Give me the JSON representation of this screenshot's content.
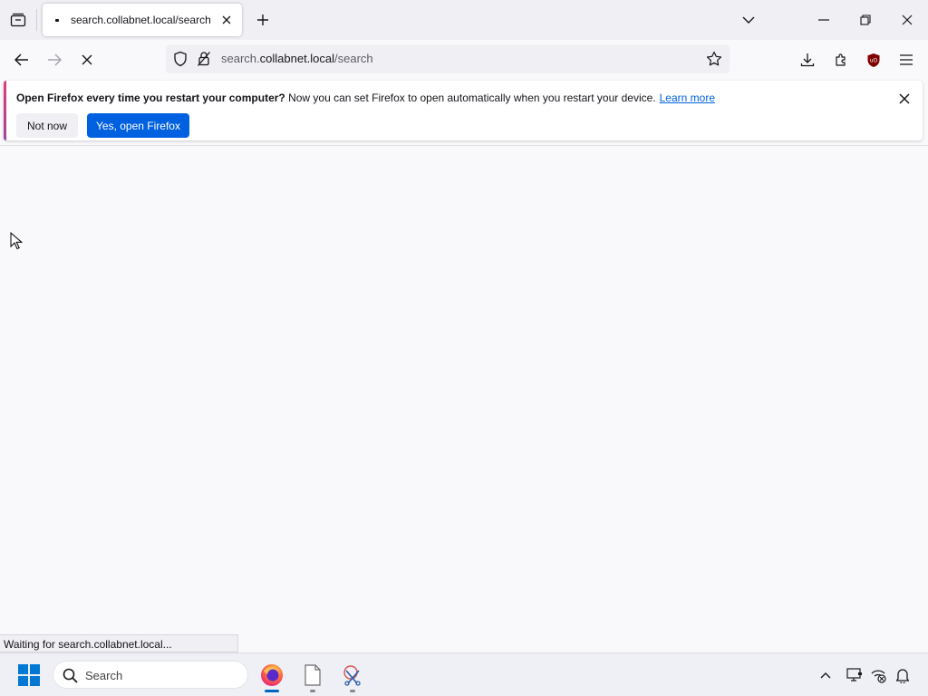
{
  "browser": {
    "tab": {
      "title": "search.collabnet.local/search"
    },
    "url": {
      "prefix": "search.",
      "host": "collabnet.local",
      "path": "/search"
    }
  },
  "notification": {
    "bold_text": "Open Firefox every time you restart your computer?",
    "text": " Now you can set Firefox to open automatically when you restart your device.",
    "link": "Learn more",
    "secondary_button": "Not now",
    "primary_button": "Yes, open Firefox"
  },
  "status_bar": {
    "text": "Waiting for search.collabnet.local..."
  },
  "taskbar": {
    "search_placeholder": "Search",
    "apps": [
      "firefox-icon",
      "file-icon",
      "snipping-tool-icon"
    ]
  },
  "colors": {
    "accent": "#0061e0",
    "tab_bg": "#f0f0f4",
    "page_bg": "#f9f9fb"
  }
}
